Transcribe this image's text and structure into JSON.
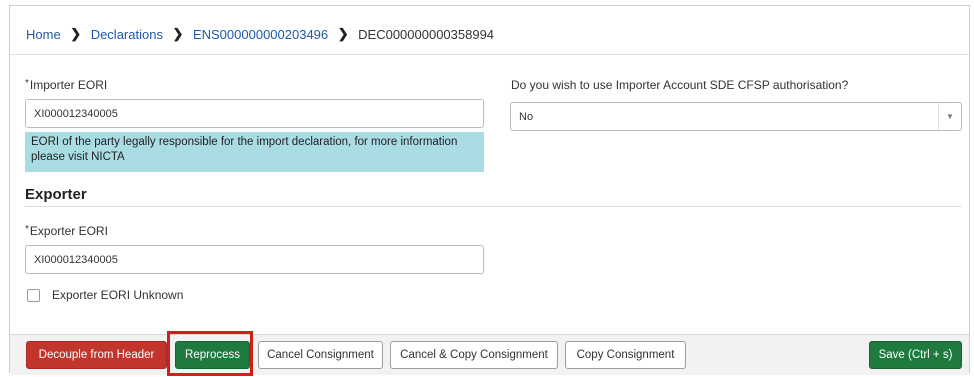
{
  "breadcrumb": {
    "home": "Home",
    "declarations": "Declarations",
    "ens": "ENS000000000203496",
    "current": "DEC000000000358994"
  },
  "importer": {
    "required_mark": "*",
    "label": "Importer EORI",
    "value": "XI000012340005",
    "hint": "EORI of the party legally responsible for the import declaration, for more information please visit NICTA"
  },
  "authorisation": {
    "label": "Do you wish to use Importer Account SDE CFSP authorisation?",
    "selected": "No",
    "caret_icon": "chevron-down-icon"
  },
  "exporter": {
    "section_title": "Exporter",
    "required_mark": "*",
    "label": "Exporter EORI",
    "value": "XI000012340005",
    "unknown_label": "Exporter EORI Unknown",
    "unknown_checked": false
  },
  "actions": {
    "decouple": "Decouple from Header",
    "reprocess": "Reprocess",
    "cancel_consignment": "Cancel Consignment",
    "cancel_copy": "Cancel & Copy Consignment",
    "copy": "Copy Consignment",
    "save": "Save (Ctrl + s)"
  },
  "colors": {
    "link": "#1f5aa6",
    "danger": "#c2352c",
    "success": "#1e7a3f",
    "hint_bg": "#a9dce3",
    "highlight": "#d0201c"
  }
}
